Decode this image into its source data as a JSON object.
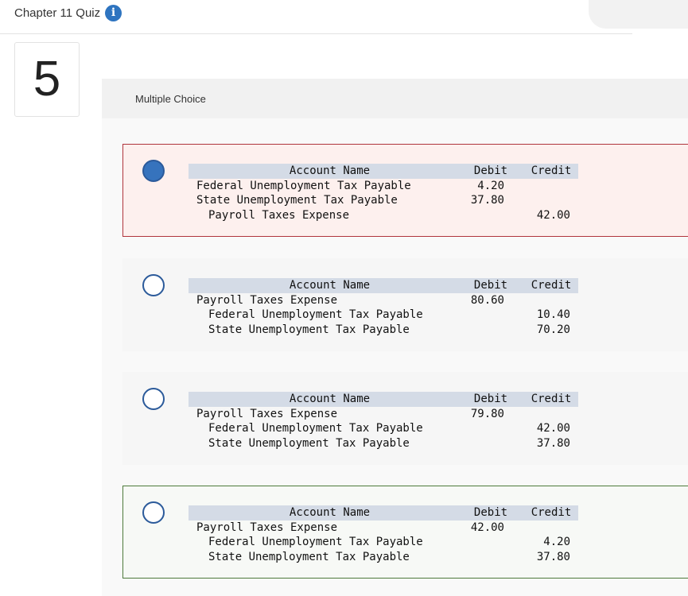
{
  "header": {
    "quiz_title": "Chapter 11 Quiz",
    "info_icon": "info-icon"
  },
  "question": {
    "number": "5",
    "type_label": "Multiple Choice"
  },
  "columns": {
    "account": "Account Name",
    "debit": "Debit",
    "credit": "Credit"
  },
  "options": [
    {
      "state": "selected-incorrect",
      "rows": [
        {
          "name": "Federal Unemployment Tax Payable",
          "debit": "4.20",
          "credit": ""
        },
        {
          "name": "State Unemployment Tax Payable",
          "debit": "37.80",
          "credit": ""
        },
        {
          "name": "Payroll Taxes Expense",
          "debit": "",
          "credit": "42.00"
        }
      ]
    },
    {
      "state": "unselected",
      "rows": [
        {
          "name": "Payroll Taxes Expense",
          "debit": "80.60",
          "credit": ""
        },
        {
          "name": "Federal Unemployment Tax Payable",
          "debit": "",
          "credit": "10.40"
        },
        {
          "name": "State Unemployment Tax Payable",
          "debit": "",
          "credit": "70.20"
        }
      ]
    },
    {
      "state": "unselected",
      "rows": [
        {
          "name": "Payroll Taxes Expense",
          "debit": "79.80",
          "credit": ""
        },
        {
          "name": "Federal Unemployment Tax Payable",
          "debit": "",
          "credit": "42.00"
        },
        {
          "name": "State Unemployment Tax Payable",
          "debit": "",
          "credit": "37.80"
        }
      ]
    },
    {
      "state": "correct",
      "rows": [
        {
          "name": "Payroll Taxes Expense",
          "debit": "42.00",
          "credit": ""
        },
        {
          "name": "Federal Unemployment Tax Payable",
          "debit": "",
          "credit": "4.20"
        },
        {
          "name": "State Unemployment Tax Payable",
          "debit": "",
          "credit": "37.80"
        }
      ]
    }
  ],
  "colors": {
    "accent": "#3673bd",
    "incorrect_border": "#b0343c",
    "incorrect_bg": "#fdf0ee",
    "correct_border": "#4e7a3b",
    "table_header_bg": "#d4dbe6"
  }
}
